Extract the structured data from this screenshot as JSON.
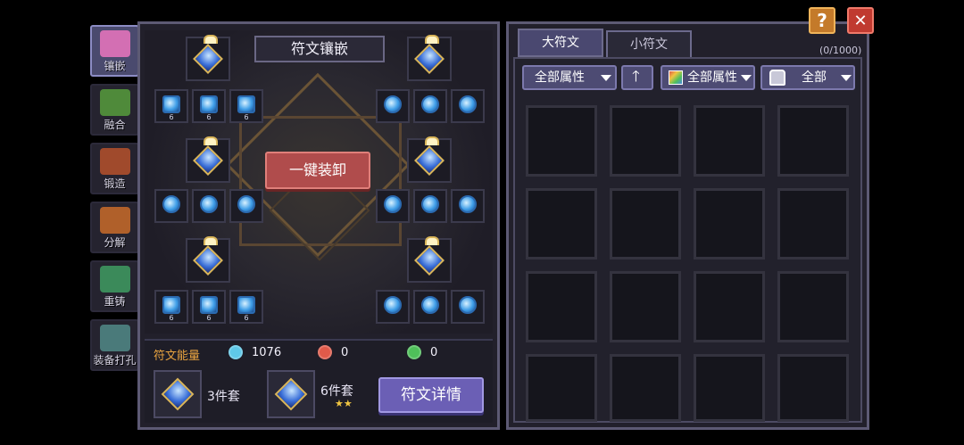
{
  "side_tabs": [
    {
      "label": "镶嵌",
      "icon": "inlay-icon",
      "color": "#d36fb3",
      "active": true
    },
    {
      "label": "融合",
      "icon": "fusion-icon",
      "color": "#4f8a3a",
      "active": false
    },
    {
      "label": "锻造",
      "icon": "forge-icon",
      "color": "#a04a2c",
      "active": false
    },
    {
      "label": "分解",
      "icon": "decompose-icon",
      "color": "#b0602a",
      "active": false
    },
    {
      "label": "重铸",
      "icon": "recast-icon",
      "color": "#3b8a5a",
      "active": false
    },
    {
      "label": "装备打孔",
      "icon": "socket-icon",
      "color": "#4a7a7a",
      "active": false
    }
  ],
  "inlay": {
    "title": "符文镶嵌",
    "unequip_all": "一键装卸",
    "small_rune_levels": [
      "6",
      "6",
      "6"
    ],
    "energy_label": "符文能量",
    "energy": [
      {
        "icon": "blue-energy-icon",
        "value": "1076",
        "color": "#5fc8e8"
      },
      {
        "icon": "red-energy-icon",
        "value": "0",
        "color": "#e05a4a"
      },
      {
        "icon": "green-energy-icon",
        "value": "0",
        "color": "#4fc05a"
      }
    ],
    "set_three": "3件套",
    "set_six": "6件套",
    "stars": "★★",
    "detail_button": "符文详情"
  },
  "storage": {
    "tabs": [
      "大符文",
      "小符文"
    ],
    "count": "(0/1000)",
    "filter_attr": "全部属性",
    "filter_color_attr": "全部属性",
    "filter_all": "全部"
  },
  "controls": {
    "help": "?",
    "close": "✕"
  }
}
